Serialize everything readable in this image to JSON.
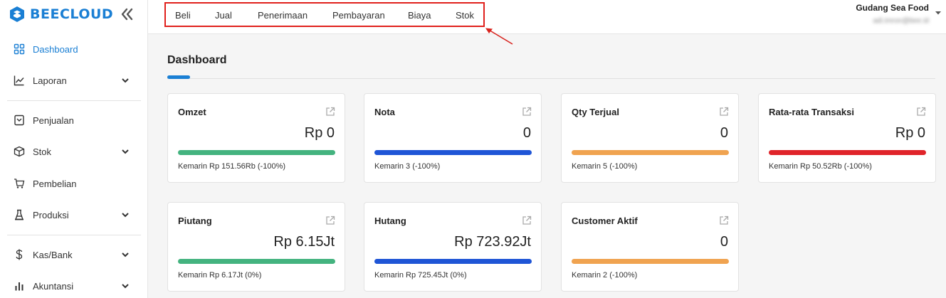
{
  "app": {
    "logo_text": "BEECLOUD"
  },
  "sidebar": {
    "items": [
      {
        "label": "Dashboard",
        "icon": "dashboard-grid-icon",
        "active": true,
        "expandable": false
      },
      {
        "label": "Laporan",
        "icon": "chart-line-icon",
        "expandable": true
      },
      {
        "label": "Penjualan",
        "icon": "receipt-icon",
        "expandable": false
      },
      {
        "label": "Stok",
        "icon": "box-icon",
        "expandable": true
      },
      {
        "label": "Pembelian",
        "icon": "cart-icon",
        "expandable": false
      },
      {
        "label": "Produksi",
        "icon": "factory-icon",
        "expandable": true
      },
      {
        "label": "Kas/Bank",
        "icon": "dollar-icon",
        "expandable": true
      },
      {
        "label": "Akuntansi",
        "icon": "bar-chart-icon",
        "expandable": true
      }
    ]
  },
  "topbar": {
    "menu": [
      "Beli",
      "Jual",
      "Penerimaan",
      "Pembayaran",
      "Biaya",
      "Stok"
    ],
    "company": "Gudang Sea Food",
    "email": "adi.imron@bee.id"
  },
  "page": {
    "title": "Dashboard"
  },
  "cards": [
    {
      "title": "Omzet",
      "value": "Rp 0",
      "note": "Kemarin Rp 151.56Rb (-100%)",
      "color": "#44b37f"
    },
    {
      "title": "Nota",
      "value": "0",
      "note": "Kemarin 3 (-100%)",
      "color": "#1f55d6"
    },
    {
      "title": "Qty Terjual",
      "value": "0",
      "note": "Kemarin 5 (-100%)",
      "color": "#f0a350"
    },
    {
      "title": "Rata-rata Transaksi",
      "value": "Rp 0",
      "note": "Kemarin Rp 50.52Rb (-100%)",
      "color": "#e0242a"
    },
    {
      "title": "Piutang",
      "value": "Rp 6.15Jt",
      "note": "Kemarin Rp 6.17Jt (0%)",
      "color": "#44b37f"
    },
    {
      "title": "Hutang",
      "value": "Rp 723.92Jt",
      "note": "Kemarin Rp 725.45Jt (0%)",
      "color": "#1f55d6"
    },
    {
      "title": "Customer Aktif",
      "value": "0",
      "note": "Kemarin 2 (-100%)",
      "color": "#f0a350"
    }
  ],
  "colors": {
    "accent": "#1a7fd4",
    "highlight_box": "#e0201c"
  }
}
